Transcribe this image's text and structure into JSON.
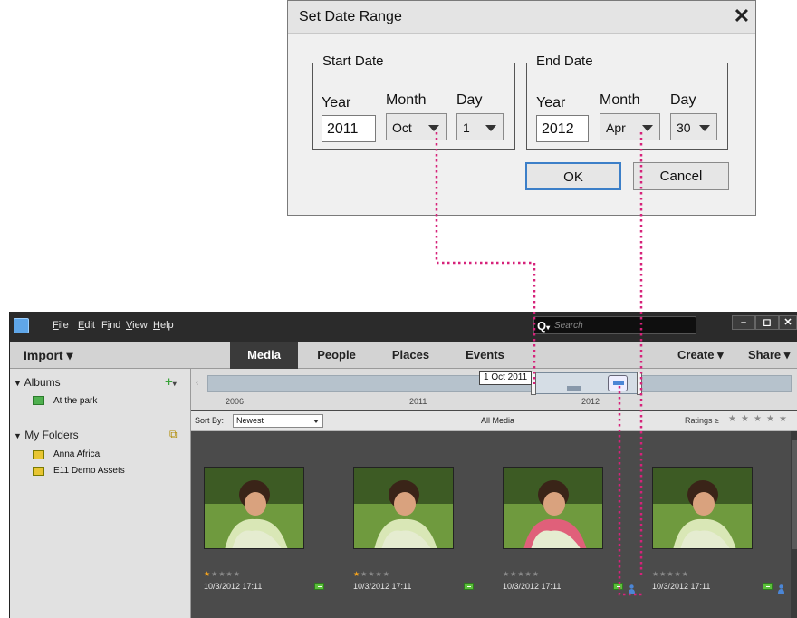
{
  "dialog": {
    "title": "Set Date Range",
    "close_glyph": "✕",
    "start": {
      "legend": "Start Date",
      "year_label": "Year",
      "month_label": "Month",
      "day_label": "Day",
      "year": "2011",
      "month": "Oct",
      "day": "1"
    },
    "end": {
      "legend": "End Date",
      "year_label": "Year",
      "month_label": "Month",
      "day_label": "Day",
      "year": "2012",
      "month": "Apr",
      "day": "30"
    },
    "ok_label": "OK",
    "cancel_label": "Cancel"
  },
  "organizer": {
    "menu": [
      {
        "label": "File",
        "underline": "F"
      },
      {
        "label": "Edit",
        "underline": "E"
      },
      {
        "label": "Find",
        "underline": "i"
      },
      {
        "label": "View",
        "underline": "V"
      },
      {
        "label": "Help",
        "underline": "H"
      }
    ],
    "search_placeholder": "Search",
    "window_buttons": [
      "–",
      "◻",
      "✕"
    ],
    "import_label": "Import ▾",
    "tabs": [
      "Media",
      "People",
      "Places",
      "Events"
    ],
    "active_tab": "Media",
    "create_label": "Create ▾",
    "share_label": "Share ▾",
    "sidebar": {
      "albums_label": "Albums",
      "albums": [
        "At the park"
      ],
      "folders_label": "My Folders",
      "folders": [
        "Anna Africa",
        "E11 Demo Assets"
      ]
    },
    "timeline": {
      "years": [
        "2006",
        "2011",
        "2012"
      ],
      "tooltip": "1 Oct 2011"
    },
    "sortbar": {
      "label": "Sort By:",
      "value": "Newest",
      "center_label": "All Media",
      "ratings_label": "Ratings ≥"
    },
    "photos": [
      {
        "stars": 1,
        "date": "10/3/2012 17:11",
        "person_tag": false
      },
      {
        "stars": 1,
        "date": "10/3/2012 17:11",
        "person_tag": false
      },
      {
        "stars": 0,
        "date": "10/3/2012 17:11",
        "person_tag": true
      },
      {
        "stars": 0,
        "date": "10/3/2012 17:11",
        "person_tag": true
      }
    ]
  },
  "colors": {
    "leader": "#d6227a",
    "menubar": "#2b2b2b",
    "grid": "#4b4b4b",
    "star_on": "#f2a21e",
    "tag": "#5bbf3a",
    "person": "#4b86d6"
  },
  "icons": {
    "close": "close-icon",
    "dropdown": "chevron-down-icon",
    "search": "search-icon",
    "add_album": "plus-icon",
    "folder": "folder-icon",
    "album": "album-icon",
    "tag": "keyword-tag-icon",
    "person": "person-tag-icon"
  }
}
